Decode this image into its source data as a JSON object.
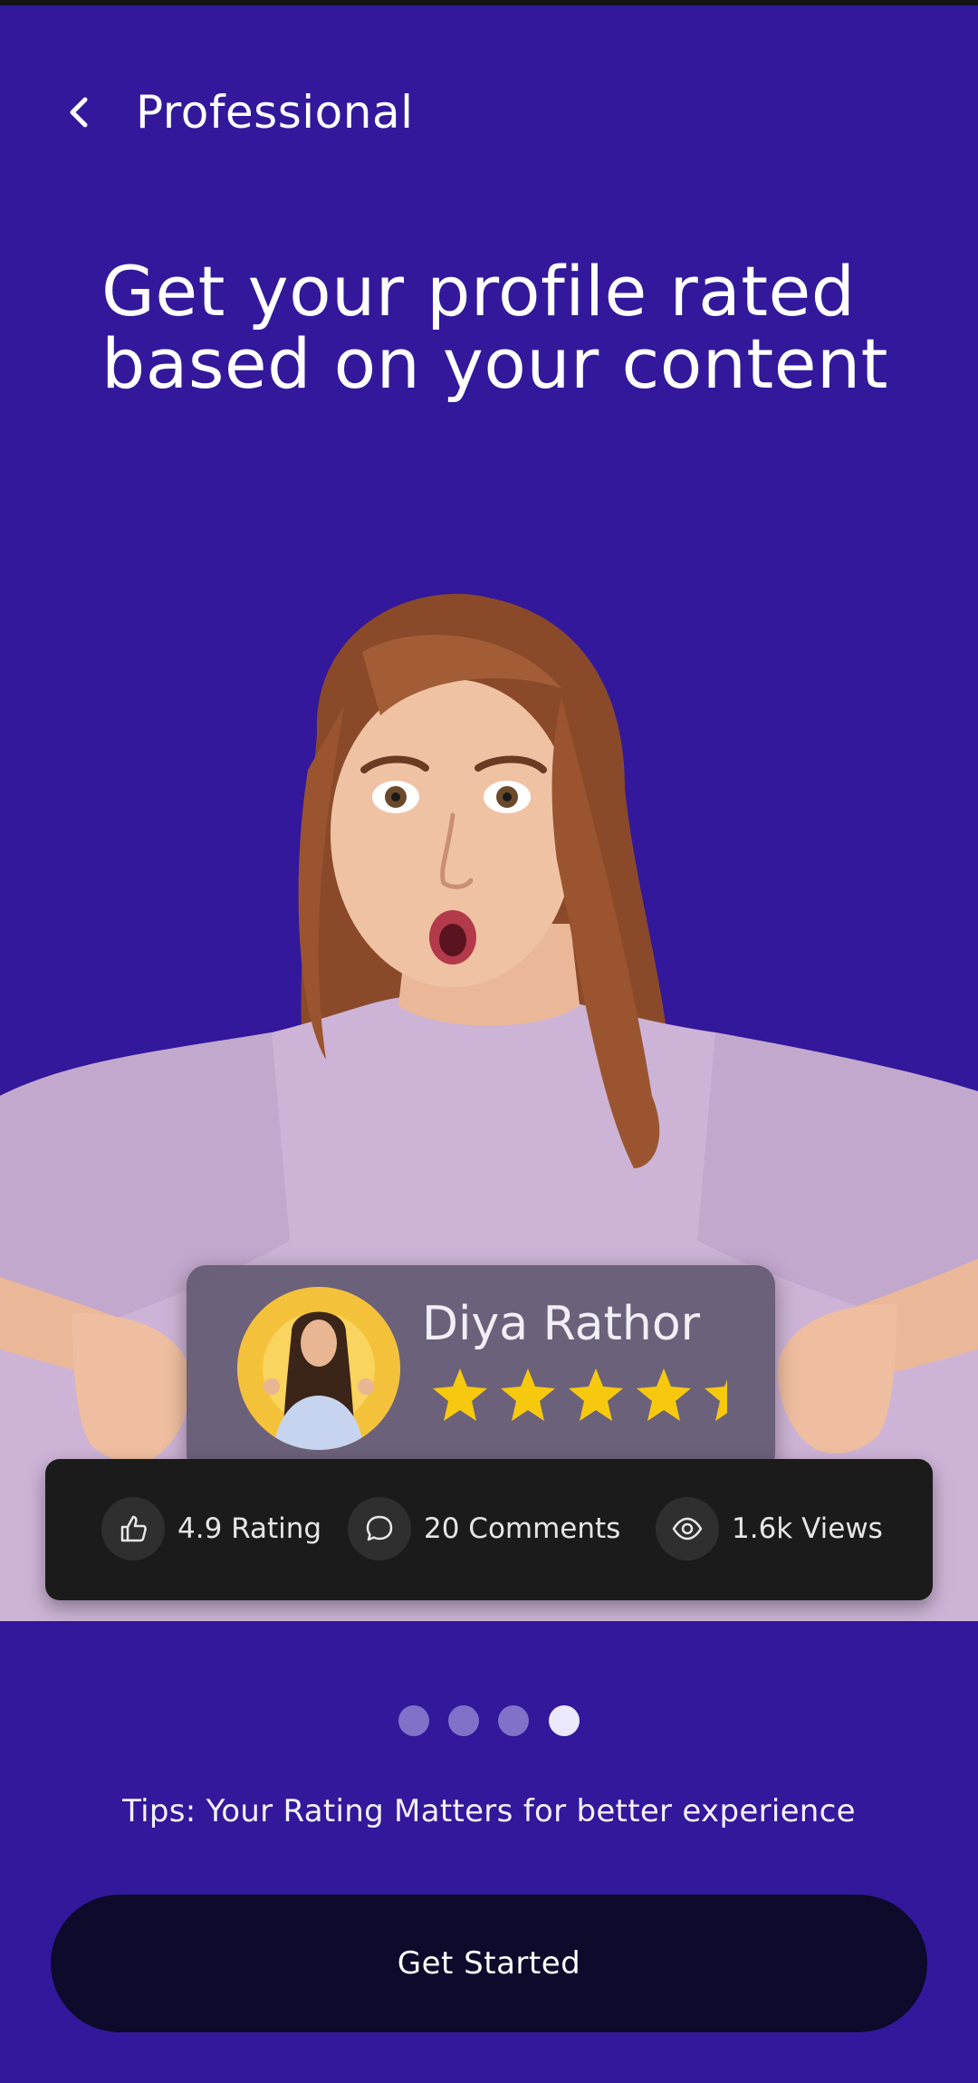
{
  "header": {
    "title": "Professional"
  },
  "headline": "Get your profile rated based on your content",
  "profile_card": {
    "name": "Diya Rathor",
    "rating_stars": 4.5,
    "star_color": "#f7c90e"
  },
  "stats": [
    {
      "icon": "thumbs-up-icon",
      "label": "4.9 Rating"
    },
    {
      "icon": "comment-icon",
      "label": "20 Comments"
    },
    {
      "icon": "eye-icon",
      "label": "1.6k Views"
    }
  ],
  "pagination": {
    "total": 4,
    "active_index": 3
  },
  "tips": "Tips: Your Rating Matters for better experience",
  "cta": {
    "label": "Get Started"
  },
  "colors": {
    "background": "#33189b",
    "button": "#0e0a2c",
    "accent_yellow": "#f4c23a"
  }
}
